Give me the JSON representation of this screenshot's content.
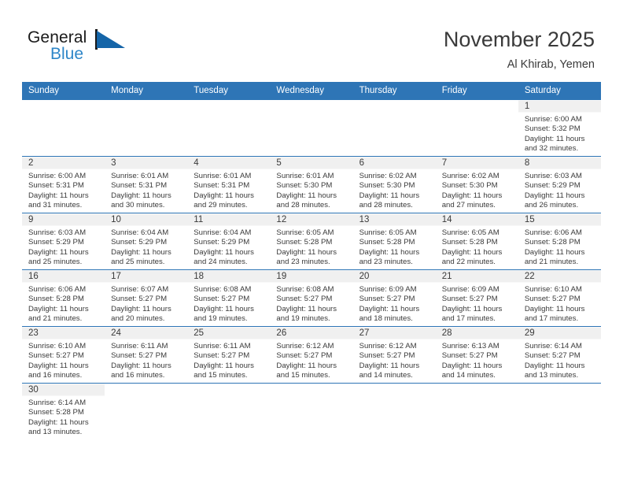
{
  "brand": {
    "name_top": "General",
    "name_bottom": "Blue",
    "flag_icon": "flag-triangle-icon",
    "accent_color": "#2E86C8"
  },
  "header": {
    "title": "November 2025",
    "subtitle": "Al Khirab, Yemen"
  },
  "theme": {
    "header_bg": "#2E75B6",
    "header_text": "#FFFFFF",
    "daynum_band": "#F0F0F0",
    "row_border": "#2E75B6",
    "body_text": "#3A3A3A"
  },
  "calendar": {
    "weekday_headers": [
      "Sunday",
      "Monday",
      "Tuesday",
      "Wednesday",
      "Thursday",
      "Friday",
      "Saturday"
    ],
    "weeks": [
      [
        {
          "day": ""
        },
        {
          "day": ""
        },
        {
          "day": ""
        },
        {
          "day": ""
        },
        {
          "day": ""
        },
        {
          "day": ""
        },
        {
          "day": "1",
          "sunrise": "Sunrise: 6:00 AM",
          "sunset": "Sunset: 5:32 PM",
          "daylight1": "Daylight: 11 hours",
          "daylight2": "and 32 minutes."
        }
      ],
      [
        {
          "day": "2",
          "sunrise": "Sunrise: 6:00 AM",
          "sunset": "Sunset: 5:31 PM",
          "daylight1": "Daylight: 11 hours",
          "daylight2": "and 31 minutes."
        },
        {
          "day": "3",
          "sunrise": "Sunrise: 6:01 AM",
          "sunset": "Sunset: 5:31 PM",
          "daylight1": "Daylight: 11 hours",
          "daylight2": "and 30 minutes."
        },
        {
          "day": "4",
          "sunrise": "Sunrise: 6:01 AM",
          "sunset": "Sunset: 5:31 PM",
          "daylight1": "Daylight: 11 hours",
          "daylight2": "and 29 minutes."
        },
        {
          "day": "5",
          "sunrise": "Sunrise: 6:01 AM",
          "sunset": "Sunset: 5:30 PM",
          "daylight1": "Daylight: 11 hours",
          "daylight2": "and 28 minutes."
        },
        {
          "day": "6",
          "sunrise": "Sunrise: 6:02 AM",
          "sunset": "Sunset: 5:30 PM",
          "daylight1": "Daylight: 11 hours",
          "daylight2": "and 28 minutes."
        },
        {
          "day": "7",
          "sunrise": "Sunrise: 6:02 AM",
          "sunset": "Sunset: 5:30 PM",
          "daylight1": "Daylight: 11 hours",
          "daylight2": "and 27 minutes."
        },
        {
          "day": "8",
          "sunrise": "Sunrise: 6:03 AM",
          "sunset": "Sunset: 5:29 PM",
          "daylight1": "Daylight: 11 hours",
          "daylight2": "and 26 minutes."
        }
      ],
      [
        {
          "day": "9",
          "sunrise": "Sunrise: 6:03 AM",
          "sunset": "Sunset: 5:29 PM",
          "daylight1": "Daylight: 11 hours",
          "daylight2": "and 25 minutes."
        },
        {
          "day": "10",
          "sunrise": "Sunrise: 6:04 AM",
          "sunset": "Sunset: 5:29 PM",
          "daylight1": "Daylight: 11 hours",
          "daylight2": "and 25 minutes."
        },
        {
          "day": "11",
          "sunrise": "Sunrise: 6:04 AM",
          "sunset": "Sunset: 5:29 PM",
          "daylight1": "Daylight: 11 hours",
          "daylight2": "and 24 minutes."
        },
        {
          "day": "12",
          "sunrise": "Sunrise: 6:05 AM",
          "sunset": "Sunset: 5:28 PM",
          "daylight1": "Daylight: 11 hours",
          "daylight2": "and 23 minutes."
        },
        {
          "day": "13",
          "sunrise": "Sunrise: 6:05 AM",
          "sunset": "Sunset: 5:28 PM",
          "daylight1": "Daylight: 11 hours",
          "daylight2": "and 23 minutes."
        },
        {
          "day": "14",
          "sunrise": "Sunrise: 6:05 AM",
          "sunset": "Sunset: 5:28 PM",
          "daylight1": "Daylight: 11 hours",
          "daylight2": "and 22 minutes."
        },
        {
          "day": "15",
          "sunrise": "Sunrise: 6:06 AM",
          "sunset": "Sunset: 5:28 PM",
          "daylight1": "Daylight: 11 hours",
          "daylight2": "and 21 minutes."
        }
      ],
      [
        {
          "day": "16",
          "sunrise": "Sunrise: 6:06 AM",
          "sunset": "Sunset: 5:28 PM",
          "daylight1": "Daylight: 11 hours",
          "daylight2": "and 21 minutes."
        },
        {
          "day": "17",
          "sunrise": "Sunrise: 6:07 AM",
          "sunset": "Sunset: 5:27 PM",
          "daylight1": "Daylight: 11 hours",
          "daylight2": "and 20 minutes."
        },
        {
          "day": "18",
          "sunrise": "Sunrise: 6:08 AM",
          "sunset": "Sunset: 5:27 PM",
          "daylight1": "Daylight: 11 hours",
          "daylight2": "and 19 minutes."
        },
        {
          "day": "19",
          "sunrise": "Sunrise: 6:08 AM",
          "sunset": "Sunset: 5:27 PM",
          "daylight1": "Daylight: 11 hours",
          "daylight2": "and 19 minutes."
        },
        {
          "day": "20",
          "sunrise": "Sunrise: 6:09 AM",
          "sunset": "Sunset: 5:27 PM",
          "daylight1": "Daylight: 11 hours",
          "daylight2": "and 18 minutes."
        },
        {
          "day": "21",
          "sunrise": "Sunrise: 6:09 AM",
          "sunset": "Sunset: 5:27 PM",
          "daylight1": "Daylight: 11 hours",
          "daylight2": "and 17 minutes."
        },
        {
          "day": "22",
          "sunrise": "Sunrise: 6:10 AM",
          "sunset": "Sunset: 5:27 PM",
          "daylight1": "Daylight: 11 hours",
          "daylight2": "and 17 minutes."
        }
      ],
      [
        {
          "day": "23",
          "sunrise": "Sunrise: 6:10 AM",
          "sunset": "Sunset: 5:27 PM",
          "daylight1": "Daylight: 11 hours",
          "daylight2": "and 16 minutes."
        },
        {
          "day": "24",
          "sunrise": "Sunrise: 6:11 AM",
          "sunset": "Sunset: 5:27 PM",
          "daylight1": "Daylight: 11 hours",
          "daylight2": "and 16 minutes."
        },
        {
          "day": "25",
          "sunrise": "Sunrise: 6:11 AM",
          "sunset": "Sunset: 5:27 PM",
          "daylight1": "Daylight: 11 hours",
          "daylight2": "and 15 minutes."
        },
        {
          "day": "26",
          "sunrise": "Sunrise: 6:12 AM",
          "sunset": "Sunset: 5:27 PM",
          "daylight1": "Daylight: 11 hours",
          "daylight2": "and 15 minutes."
        },
        {
          "day": "27",
          "sunrise": "Sunrise: 6:12 AM",
          "sunset": "Sunset: 5:27 PM",
          "daylight1": "Daylight: 11 hours",
          "daylight2": "and 14 minutes."
        },
        {
          "day": "28",
          "sunrise": "Sunrise: 6:13 AM",
          "sunset": "Sunset: 5:27 PM",
          "daylight1": "Daylight: 11 hours",
          "daylight2": "and 14 minutes."
        },
        {
          "day": "29",
          "sunrise": "Sunrise: 6:14 AM",
          "sunset": "Sunset: 5:27 PM",
          "daylight1": "Daylight: 11 hours",
          "daylight2": "and 13 minutes."
        }
      ],
      [
        {
          "day": "30",
          "sunrise": "Sunrise: 6:14 AM",
          "sunset": "Sunset: 5:28 PM",
          "daylight1": "Daylight: 11 hours",
          "daylight2": "and 13 minutes."
        },
        {
          "day": ""
        },
        {
          "day": ""
        },
        {
          "day": ""
        },
        {
          "day": ""
        },
        {
          "day": ""
        },
        {
          "day": ""
        }
      ]
    ]
  }
}
